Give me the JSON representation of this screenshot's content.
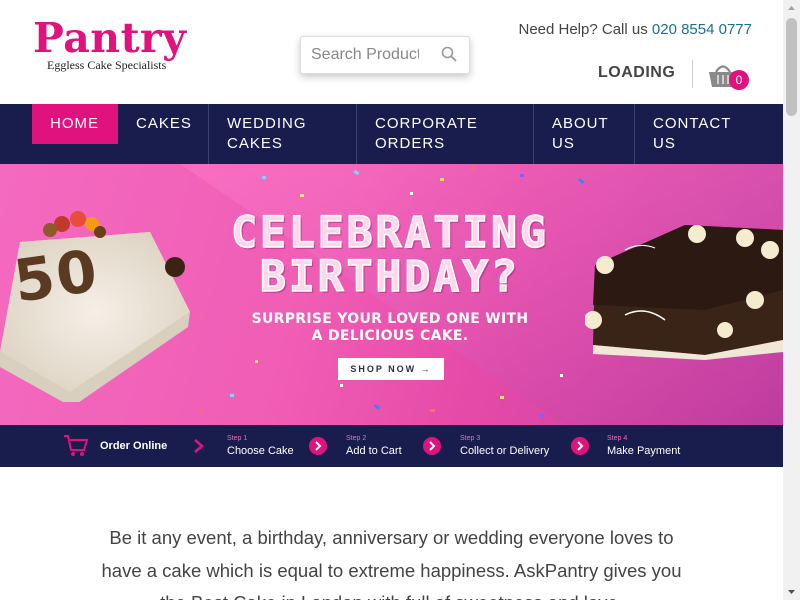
{
  "brand": {
    "name": "Pantry",
    "tagline": "Eggless Cake Specialists",
    "color": "#e0127d"
  },
  "search": {
    "placeholder": "Search Products",
    "icon": "search-icon"
  },
  "help": {
    "prefix": "Need Help? Call us ",
    "phone": "020 8554 0777"
  },
  "status": {
    "loading": "LOADING"
  },
  "cart": {
    "count": "0",
    "icon": "basket-icon"
  },
  "nav": {
    "items": [
      {
        "line1": "HOME",
        "line2": "",
        "active": true
      },
      {
        "line1": "CAKES",
        "line2": ""
      },
      {
        "line1": "WEDDING",
        "line2": "CAKES"
      },
      {
        "line1": "CORPORATE",
        "line2": "ORDERS"
      },
      {
        "line1": "ABOUT",
        "line2": "US"
      },
      {
        "line1": "CONTACT",
        "line2": "US"
      }
    ],
    "bg_color": "#181d4e"
  },
  "banner": {
    "headline_line1": "CELEBRATING",
    "headline_line2": "BIRTHDAY?",
    "sub_line1": "SURPRISE YOUR LOVED ONE WITH",
    "sub_line2": "A DELICIOUS CAKE.",
    "cta": "SHOP NOW →",
    "cake_left_number": "50"
  },
  "steps": {
    "order_online": "Order Online",
    "items": [
      {
        "small": "Step 1",
        "label": "Choose Cake"
      },
      {
        "small": "Step 2",
        "label": "Add to Cart"
      },
      {
        "small": "Step 3",
        "label": "Collect or Delivery"
      },
      {
        "small": "Step 4",
        "label": "Make Payment"
      }
    ]
  },
  "intro": {
    "line1": "Be it any event, a birthday, anniversary or wedding everyone loves to",
    "line2": "have a cake which is equal to extreme happiness. AskPantry gives you",
    "line3": "the Best Cake in London with full of sweetness and love."
  }
}
